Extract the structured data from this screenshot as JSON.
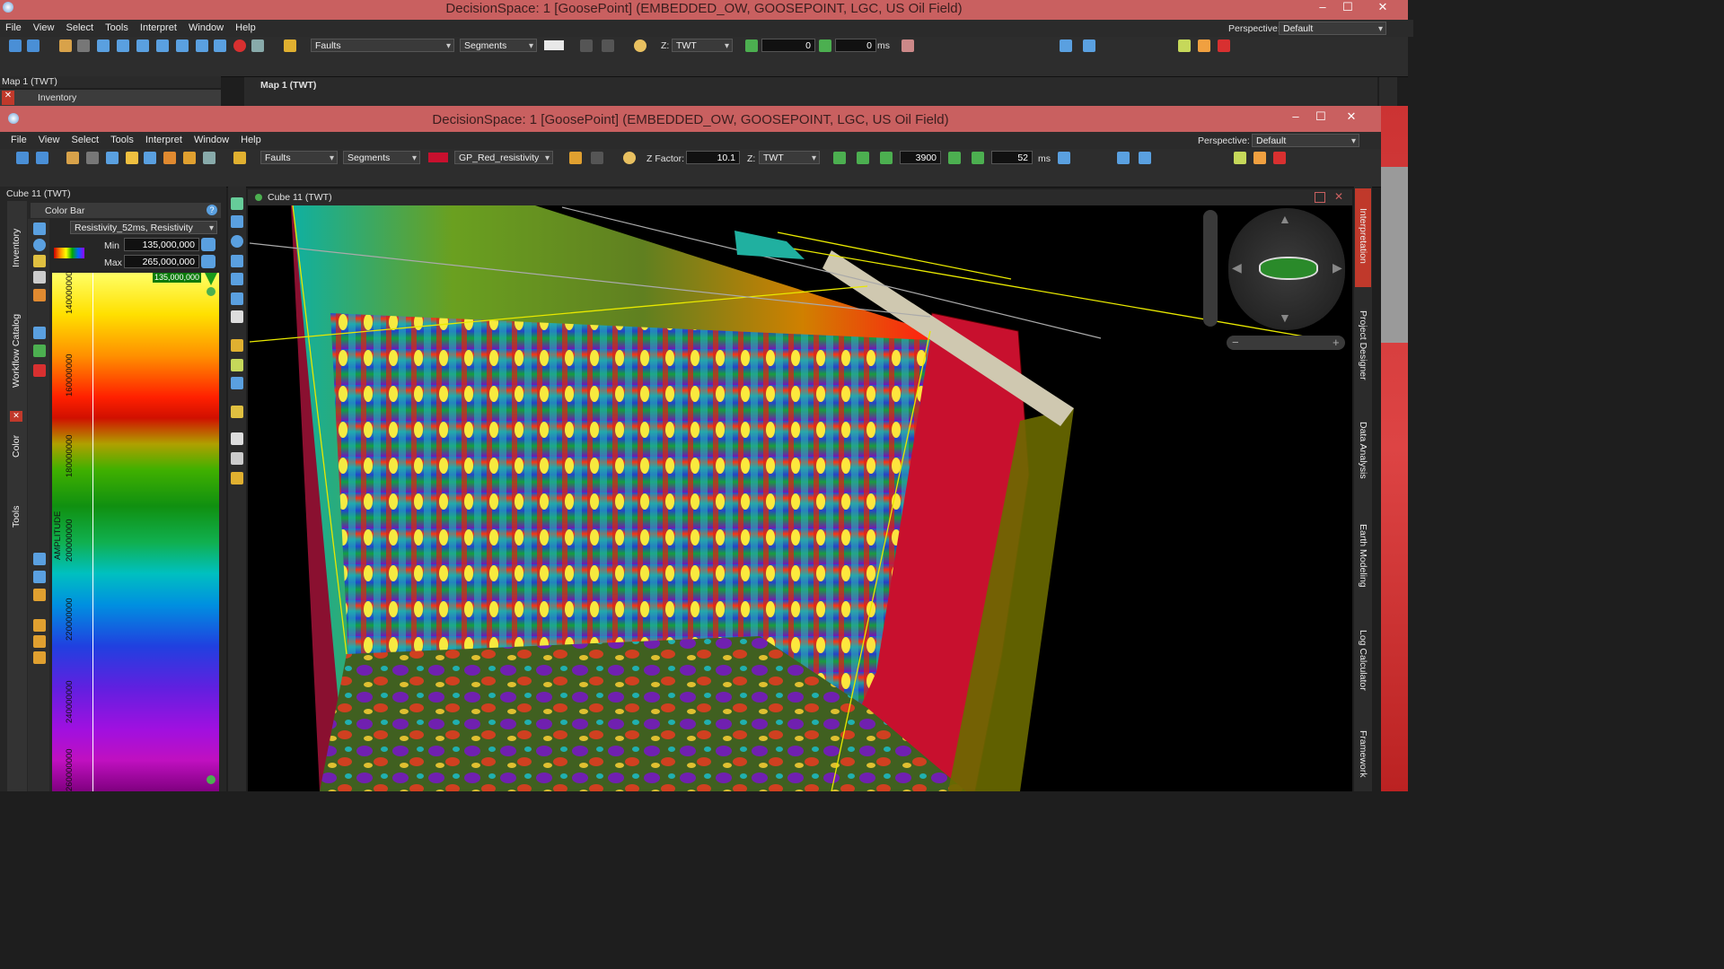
{
  "back_window": {
    "title": "DecisionSpace: 1 [GoosePoint] (EMBEDDED_OW, GOOSEPOINT, LGC, US Oil Field)",
    "menu": [
      "File",
      "View",
      "Select",
      "Tools",
      "Interpret",
      "Window",
      "Help"
    ],
    "perspective_label": "Perspective:",
    "perspective_value": "Default",
    "toolbar": {
      "faults": "Faults",
      "segments": "Segments",
      "z_label": "Z:",
      "z_value": "TWT",
      "frame_value": "0",
      "time_value": "0",
      "time_unit": "ms"
    },
    "left_panel_title": "Map 1 (TWT)",
    "inventory_tab": "Inventory",
    "view_title": "Map 1 (TWT)"
  },
  "front_window": {
    "title": "DecisionSpace: 1 [GoosePoint] (EMBEDDED_OW, GOOSEPOINT, LGC, US Oil Field)",
    "menu": [
      "File",
      "View",
      "Select",
      "Tools",
      "Interpret",
      "Window",
      "Help"
    ],
    "perspective_label": "Perspective:",
    "perspective_value": "Default",
    "toolbar": {
      "faults": "Faults",
      "segments": "Segments",
      "colormap": "GP_Red_resistivity",
      "zfactor_label": "Z Factor:",
      "zfactor_value": "10.1",
      "z_label": "Z:",
      "z_value": "TWT",
      "frame_value": "3900",
      "time_value": "52",
      "time_unit": "ms"
    },
    "left_panel_title": "Cube 11 (TWT)",
    "side_tabs": [
      "Inventory",
      "Workflow Catalog",
      "Color",
      "Tools"
    ],
    "colorbar": {
      "title": "Color Bar",
      "attribute": "Resistivity_52ms, Resistivity",
      "min_label": "Min",
      "min_value": "135,000,000",
      "max_label": "Max",
      "max_value": "265,000,000",
      "marker_value": "135,000,000",
      "axis_title": "AMPLITUDE",
      "ticks": [
        "140000000",
        "160000000",
        "180000000",
        "200000000",
        "220000000",
        "240000000",
        "260000000"
      ]
    },
    "view_title": "Cube 11 (TWT)",
    "right_tabs": [
      "Interpretation",
      "Project Designer",
      "Data Analysis",
      "Earth Modeling",
      "Log Calculator",
      "Framework"
    ]
  },
  "colors": {
    "titlebar": "#c96060",
    "accent_green": "#4caf50",
    "fault_red": "#c8102e"
  }
}
